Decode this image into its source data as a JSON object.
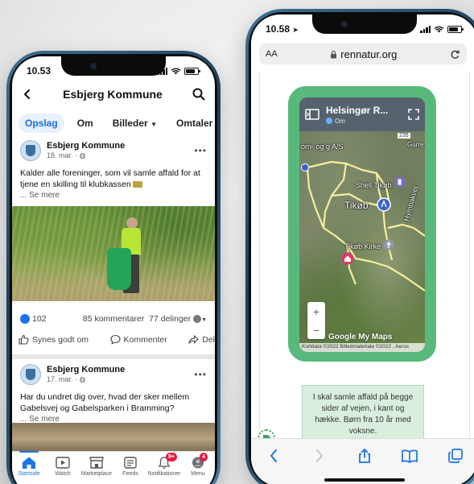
{
  "left_phone": {
    "status": {
      "time": "10.53"
    },
    "header": {
      "title": "Esbjerg Kommune"
    },
    "tabs": [
      {
        "label": "Opslag"
      },
      {
        "label": "Om"
      },
      {
        "label": "Billeder"
      },
      {
        "label": "Omtaler"
      }
    ],
    "posts": [
      {
        "author": "Esbjerg Kommune",
        "date": "18. mar. ·",
        "text": "Kalder alle foreninger, som vil samle affald for at tjene en skilling til klubkassen",
        "see_more": "... Se mere",
        "likes": "102",
        "comments": "85 kommentarer",
        "shares": "77 delinger"
      },
      {
        "author": "Esbjerg Kommune",
        "date": "17. mar. ·",
        "text": "Har du undret dig over, hvad der sker mellem Gabelsvej og Gabelsparken i Bramming?",
        "see_more": "... Se mere"
      }
    ],
    "actions": {
      "like": "Synes godt om",
      "comment": "Kommenter",
      "share": "Del"
    },
    "tabbar": [
      {
        "label": "Startside",
        "icon": "home-icon",
        "active": true
      },
      {
        "label": "Watch",
        "icon": "watch-icon"
      },
      {
        "label": "Marketplace",
        "icon": "marketplace-icon"
      },
      {
        "label": "Feeds",
        "icon": "feeds-icon"
      },
      {
        "label": "Notifikationer",
        "icon": "bell-icon",
        "badge": "9+"
      },
      {
        "label": "Menu",
        "icon": "menu-avatar-icon",
        "badge": "4"
      }
    ],
    "colors": {
      "accent": "#1b74e4",
      "badge": "#e41e3f"
    }
  },
  "right_phone": {
    "status": {
      "time": "10.58"
    },
    "url_bar": {
      "aa": "AA",
      "domain": "rennatur.org"
    },
    "map": {
      "title": "Helsingør R...",
      "subtitle": "Om",
      "labels": {
        "town": "Tikøb",
        "shell": "Shell Tikøb",
        "church": "Tikøb Kirke",
        "road": "Hymbakvej",
        "company": "orn- og\ng A/S",
        "road_number": "235",
        "corner": "Gurre"
      },
      "zoom_in": "+",
      "zoom_out": "−",
      "google": "Google My Maps",
      "attribution": "Kortdata ©2022 Billedmateriale ©2022 , Aeroc"
    },
    "info_text": "I skal samle affald på begge sider af vejen, i kant og hække. Børn fra 10 år med voksne.",
    "colors": {
      "frame": "#59b97c",
      "route": "#f6eea0"
    }
  }
}
